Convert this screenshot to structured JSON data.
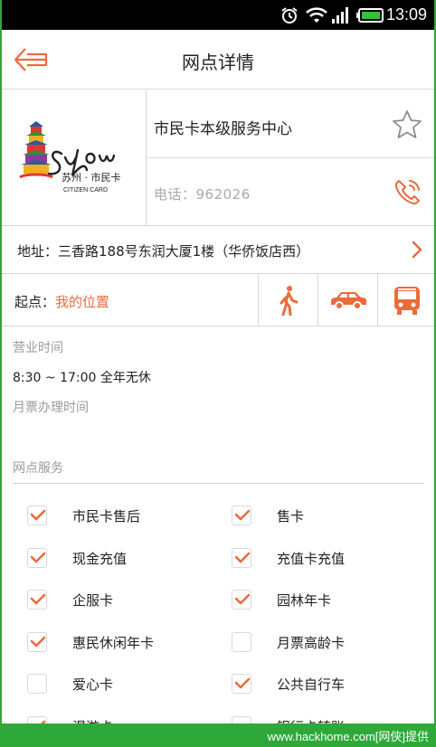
{
  "status_bar": {
    "time": "13:09"
  },
  "header": {
    "title": "网点详情"
  },
  "branch": {
    "logo_text": "Suzhou 苏州·市民卡 CITIZEN CARD",
    "name": "市民卡本级服务中心",
    "phone": "电话：962026",
    "address": "地址：三香路188号东润大厦1楼（华侨饭店西）"
  },
  "route": {
    "start_label": "起点：",
    "start_value": "我的位置",
    "modes": [
      "walk-icon",
      "car-icon",
      "bus-icon"
    ]
  },
  "hours": {
    "label": "营业时间",
    "value": "8:30 ~ 17:00 全年无休",
    "monthly_label": "月票办理时间"
  },
  "services": {
    "label": "网点服务",
    "items": [
      {
        "label": "市民卡售后",
        "checked": true
      },
      {
        "label": "售卡",
        "checked": true
      },
      {
        "label": "现金充值",
        "checked": true
      },
      {
        "label": "充值卡充值",
        "checked": true
      },
      {
        "label": "企服卡",
        "checked": true
      },
      {
        "label": "园林年卡",
        "checked": true
      },
      {
        "label": "惠民休闲年卡",
        "checked": true
      },
      {
        "label": "月票高龄卡",
        "checked": false
      },
      {
        "label": "爱心卡",
        "checked": false
      },
      {
        "label": "公共自行车",
        "checked": true
      },
      {
        "label": "漫游卡",
        "checked": true
      },
      {
        "label": "银行卡转账",
        "checked": false
      }
    ]
  },
  "watermark": "www.hackhome.com[网侠]提供",
  "colors": {
    "accent": "#ee6a3a",
    "divider": "#d7d7d7",
    "watermark_bg": "#2fa83a"
  }
}
